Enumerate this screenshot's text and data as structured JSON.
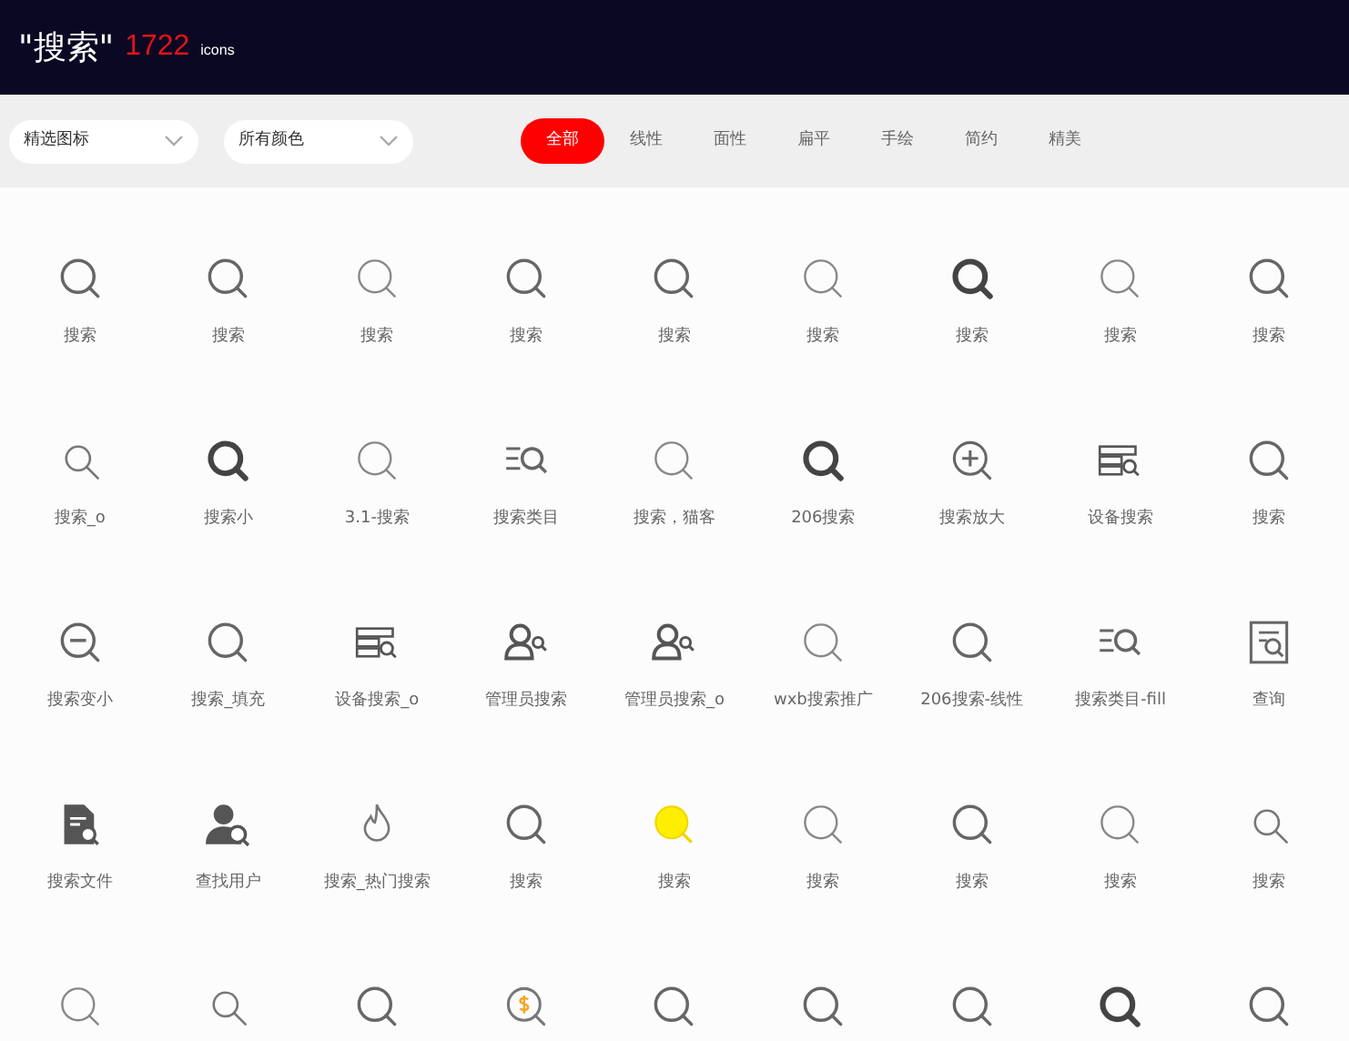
{
  "header": {
    "query": "\"搜索\"",
    "count": "1722",
    "unit": "icons"
  },
  "filters": {
    "dropdowns": [
      {
        "value": "精选图标"
      },
      {
        "value": "所有颜色"
      }
    ],
    "tabs": [
      {
        "label": "全部",
        "selected": true
      },
      {
        "label": "线性",
        "selected": false
      },
      {
        "label": "面性",
        "selected": false
      },
      {
        "label": "扁平",
        "selected": false
      },
      {
        "label": "手绘",
        "selected": false
      },
      {
        "label": "简约",
        "selected": false
      },
      {
        "label": "精美",
        "selected": false
      }
    ]
  },
  "icons": [
    {
      "kind": "magnifier",
      "label": "搜索"
    },
    {
      "kind": "magnifier",
      "label": "搜索"
    },
    {
      "kind": "magnifier-light",
      "label": "搜索"
    },
    {
      "kind": "magnifier",
      "label": "搜索"
    },
    {
      "kind": "magnifier",
      "label": "搜索"
    },
    {
      "kind": "magnifier-light",
      "label": "搜索"
    },
    {
      "kind": "magnifier-bold",
      "label": "搜索"
    },
    {
      "kind": "magnifier-light",
      "label": "搜索"
    },
    {
      "kind": "magnifier",
      "label": "搜索"
    },
    {
      "kind": "magnifier-small",
      "label": "搜索_o"
    },
    {
      "kind": "magnifier-bold",
      "label": "搜索小"
    },
    {
      "kind": "magnifier-light",
      "label": "3.1-搜索"
    },
    {
      "kind": "list-search",
      "label": "搜索类目"
    },
    {
      "kind": "magnifier-light",
      "label": "搜索，猫客"
    },
    {
      "kind": "magnifier-bold",
      "label": "206搜索"
    },
    {
      "kind": "zoom-in",
      "label": "搜索放大"
    },
    {
      "kind": "server-search",
      "label": "设备搜索"
    },
    {
      "kind": "magnifier",
      "label": "搜索"
    },
    {
      "kind": "zoom-out",
      "label": "搜索变小"
    },
    {
      "kind": "magnifier",
      "label": "搜索_填充"
    },
    {
      "kind": "server-search",
      "label": "设备搜索_o"
    },
    {
      "kind": "user-search",
      "label": "管理员搜索"
    },
    {
      "kind": "user-search",
      "label": "管理员搜索_o"
    },
    {
      "kind": "magnifier-light",
      "label": "wxb搜索推广"
    },
    {
      "kind": "magnifier",
      "label": "206搜索-线性"
    },
    {
      "kind": "list-search",
      "label": "搜索类目-fill"
    },
    {
      "kind": "doc-search",
      "label": "查询"
    },
    {
      "kind": "file-search",
      "label": "搜索文件"
    },
    {
      "kind": "person-search",
      "label": "查找用户"
    },
    {
      "kind": "flame",
      "label": "搜索_热门搜索"
    },
    {
      "kind": "magnifier",
      "label": "搜索"
    },
    {
      "kind": "magnifier-yellow",
      "label": "搜索"
    },
    {
      "kind": "magnifier-light",
      "label": "搜索"
    },
    {
      "kind": "magnifier",
      "label": "搜索"
    },
    {
      "kind": "magnifier-light",
      "label": "搜索"
    },
    {
      "kind": "magnifier-small",
      "label": "搜索"
    },
    {
      "kind": "magnifier-light"
    },
    {
      "kind": "magnifier-small"
    },
    {
      "kind": "magnifier"
    },
    {
      "kind": "magnifier-dollar"
    },
    {
      "kind": "magnifier"
    },
    {
      "kind": "magnifier"
    },
    {
      "kind": "magnifier"
    },
    {
      "kind": "magnifier-bold"
    },
    {
      "kind": "magnifier"
    }
  ]
}
